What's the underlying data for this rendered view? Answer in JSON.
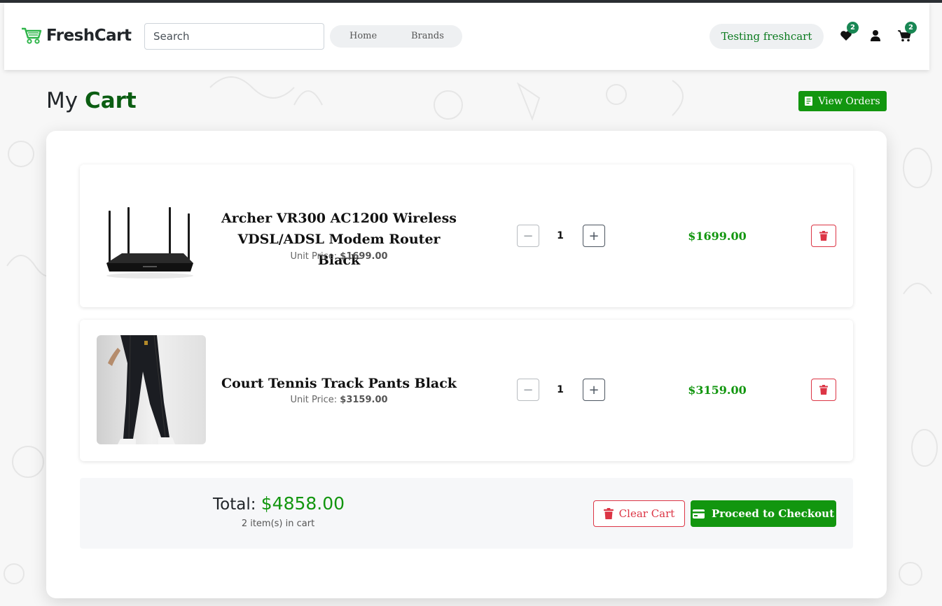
{
  "brand": {
    "name": "FreshCart",
    "icon": "cart-icon"
  },
  "search": {
    "placeholder": "Search"
  },
  "nav": {
    "home": "Home",
    "brands": "Brands"
  },
  "user": {
    "name": "Testing freshcart"
  },
  "icons": {
    "wishlist": "heart-icon",
    "account": "user-icon",
    "cart": "cart-icon"
  },
  "badges": {
    "wishlist": "2",
    "cart": "2"
  },
  "page": {
    "title_prefix": "My",
    "title_accent": "Cart",
    "view_orders": "View Orders"
  },
  "items": [
    {
      "name": "Archer VR300 AC1200 Wireless VDSL/ADSL Modem Router Black",
      "unit_label": "Unit Price:",
      "unit_price": "$1699.00",
      "qty": "1",
      "line_total": "$1699.00"
    },
    {
      "name": "Court Tennis Track Pants Black",
      "unit_label": "Unit Price:",
      "unit_price": "$3159.00",
      "qty": "1",
      "line_total": "$3159.00"
    }
  ],
  "summary": {
    "total_label": "Total:",
    "total_value": "$4858.00",
    "count": "2 item(s) in cart",
    "clear": "Clear Cart",
    "checkout": "Proceed to Checkout"
  },
  "colors": {
    "primary": "#12960f",
    "danger": "#dc3545",
    "title_accent": "#0b5d12"
  }
}
